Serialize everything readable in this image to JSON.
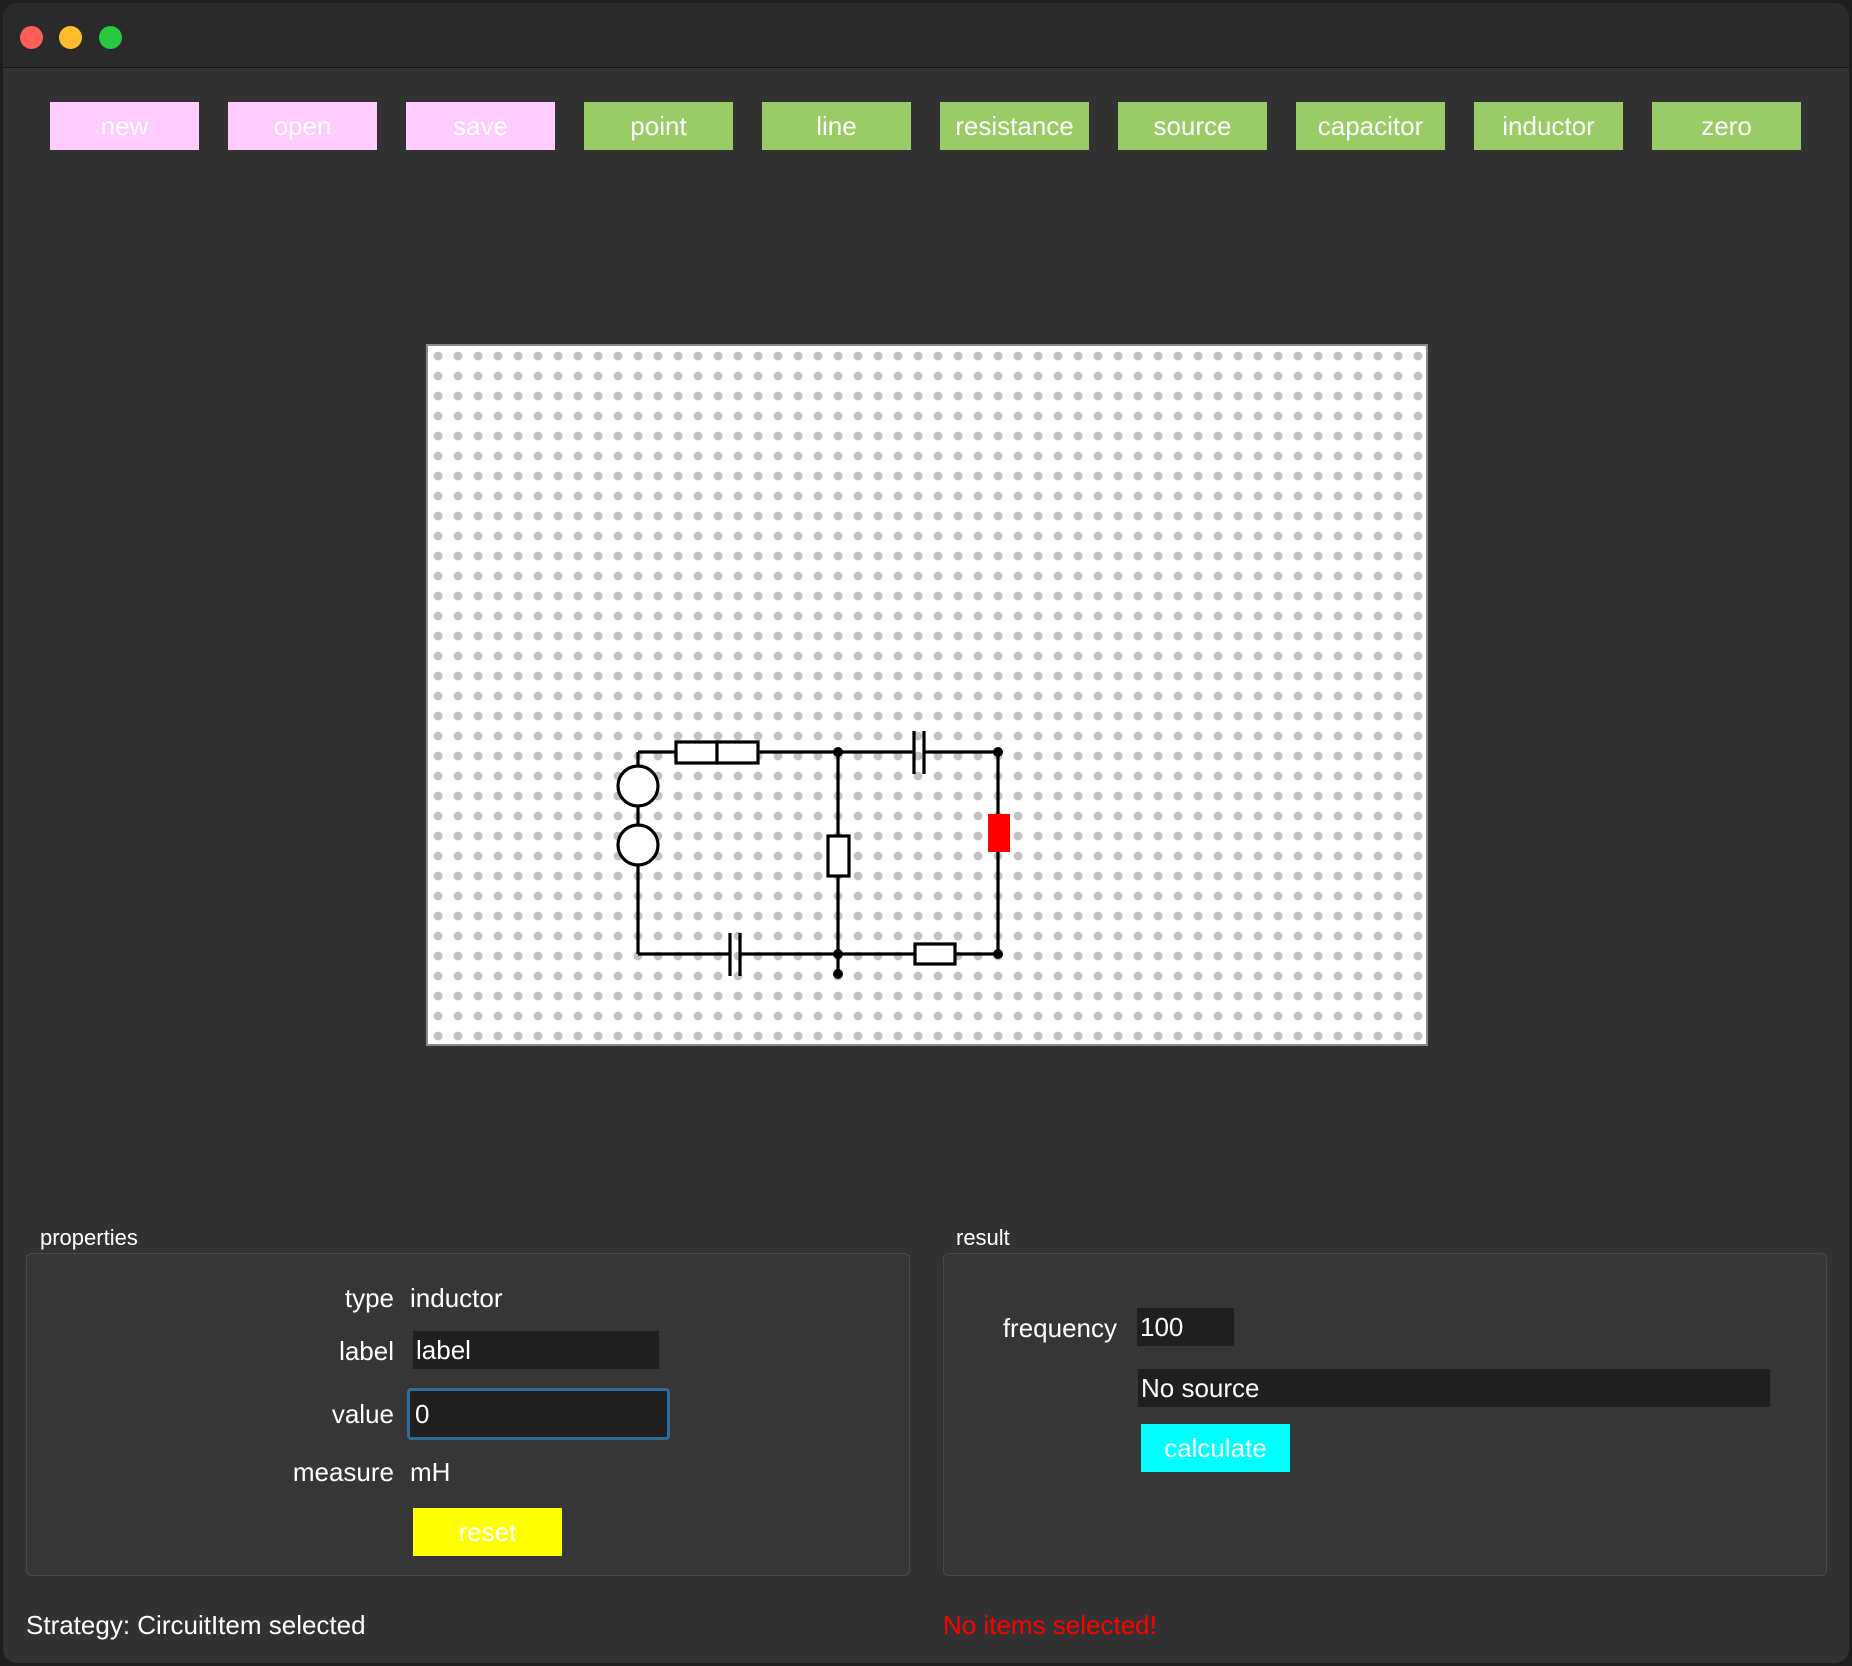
{
  "toolbar": {
    "new": "new",
    "open": "open",
    "save": "save",
    "point": "point",
    "line": "line",
    "resistance": "resistance",
    "source": "source",
    "capacitor": "capacitor",
    "inductor": "inductor",
    "zero": "zero"
  },
  "colors": {
    "file_buttons": "#ffccff",
    "tool_buttons": "#99cc66",
    "reset_button": "#ffff00",
    "calculate_button": "#00ffff",
    "selected_item": "#ff0000",
    "error_text": "#ff0000"
  },
  "properties": {
    "title": "properties",
    "type_label": "type",
    "type_value": "inductor",
    "label_label": "label",
    "label_value": "label",
    "value_label": "value",
    "value_value": "0",
    "measure_label": "measure",
    "measure_value": "mH",
    "reset": "reset"
  },
  "result": {
    "title": "result",
    "frequency_label": "frequency",
    "frequency_value": "100",
    "output": "No source",
    "calculate": "calculate"
  },
  "status": {
    "strategy": "Strategy: CircuitItem selected",
    "message": "No items selected!"
  }
}
